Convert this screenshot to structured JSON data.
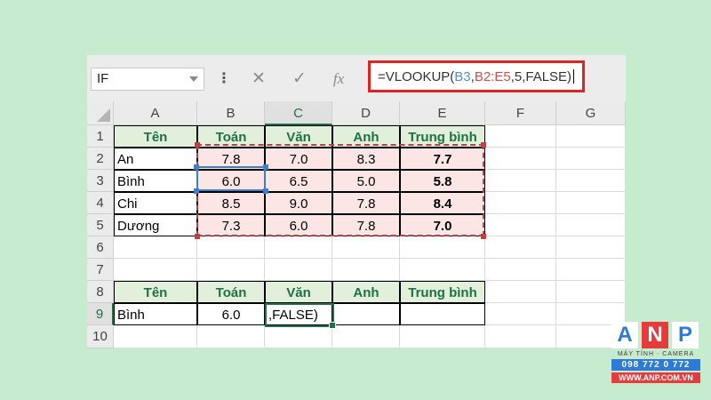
{
  "formula_bar": {
    "name_box": "IF",
    "dots": "⋮",
    "cancel_symbol": "✕",
    "enter_symbol": "✓",
    "fx_symbol": "fx",
    "formula_prefix": "=VLOOKUP(",
    "formula_ref1": "B3",
    "formula_sep": ",",
    "formula_ref2": "B2:E5",
    "formula_suffix": ",5,FALSE)"
  },
  "columns": [
    "A",
    "B",
    "C",
    "D",
    "E",
    "F",
    "G"
  ],
  "rows": [
    "1",
    "2",
    "3",
    "4",
    "5",
    "6",
    "7",
    "8",
    "9",
    "10"
  ],
  "table1": {
    "headers": [
      "Tên",
      "Toán",
      "Văn",
      "Anh",
      "Trung bình"
    ],
    "rows": [
      [
        "An",
        "7.8",
        "7.0",
        "8.3",
        "7.7"
      ],
      [
        "Bình",
        "6.0",
        "6.5",
        "5.0",
        "5.8"
      ],
      [
        "Chi",
        "8.5",
        "9.0",
        "7.8",
        "8.4"
      ],
      [
        "Dương",
        "7.3",
        "6.0",
        "7.8",
        "7.0"
      ]
    ]
  },
  "table2": {
    "headers": [
      "Tên",
      "Toán",
      "Văn",
      "Anh",
      "Trung bình"
    ],
    "row": [
      "Bình",
      "6.0",
      ",FALSE)",
      "",
      ""
    ]
  },
  "logo": {
    "letters": [
      "A",
      "N",
      "P"
    ],
    "tagline": "MÁY TÍNH · CAMERA",
    "phone": "098 772 0 772",
    "website": "WWW.ANP.COM.VN"
  },
  "colors": {
    "background": "#c6ebcf",
    "header_green": "#1e7145",
    "formula_border": "#e02424"
  }
}
